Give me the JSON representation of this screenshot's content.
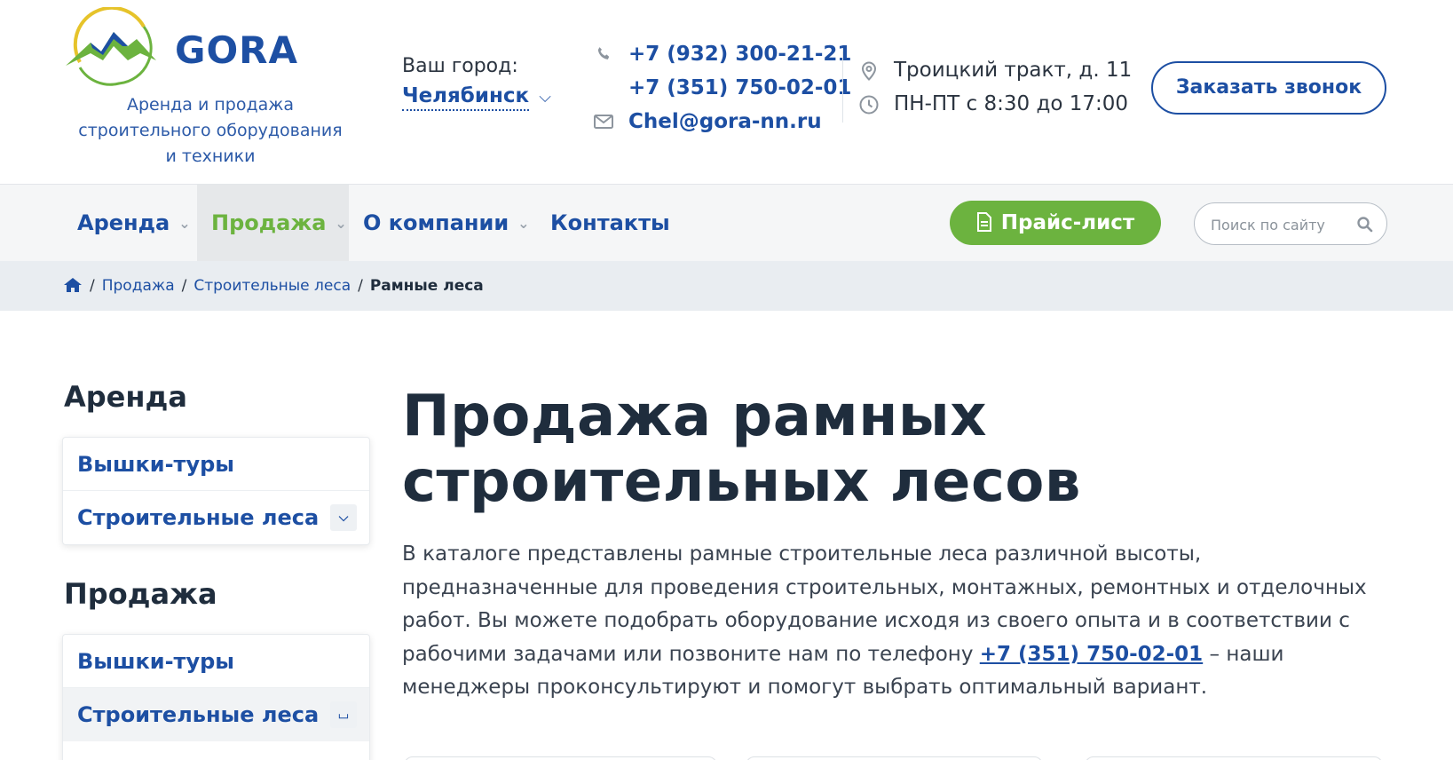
{
  "header": {
    "logo_word": "GORA",
    "tagline": [
      "Аренда и продажа",
      "строительного оборудования",
      "и техники"
    ],
    "city_label": "Ваш город:",
    "city_value": "Челябинск",
    "phones": [
      "+7 (932) 300-21-21",
      "+7 (351) 750-02-01"
    ],
    "email": "Chel@gora-nn.ru",
    "address": "Троицкий тракт, д. 11",
    "hours": "ПН-ПТ с 8:30 до 17:00",
    "callback_label": "Заказать звонок"
  },
  "nav": {
    "items": [
      {
        "label": "Аренда"
      },
      {
        "label": "Продажа"
      },
      {
        "label": "О компании"
      },
      {
        "label": "Контакты"
      }
    ],
    "price_label": "Прайс-лист",
    "search_placeholder": "Поиск по сайту"
  },
  "breadcrumbs": [
    "Продажа",
    "Строительные леса",
    "Рамные леса"
  ],
  "sidebar": {
    "rent": {
      "heading": "Аренда",
      "items": [
        "Вышки-туры",
        "Строительные леса"
      ]
    },
    "sale": {
      "heading": "Продажа",
      "items": [
        "Вышки-туры",
        "Строительные леса"
      ]
    }
  },
  "main": {
    "title_lines": [
      "Продажа рамных",
      "строительных лесов"
    ],
    "intro_before": "В каталоге представлены рамные строительные леса различной высоты, предназначенные для проведения строительных, монтажных, ремонтных и отделочных работ. Вы можете подобрать оборудование исходя из своего опыта и в соответствии с рабочими задачами или позвоните нам по телефону ",
    "intro_phone": "+7 (351) 750-02-01",
    "intro_after": " – наши менеджеры проконсультируют и помогут выбрать оптимальный вариант."
  },
  "colors": {
    "brand_blue": "#1d4fa3",
    "accent_green": "#6cb33f",
    "text_dark": "#1f2d3d"
  },
  "icons": [
    "logo-mountain-icon",
    "phone-icon",
    "mail-icon",
    "location-pin-icon",
    "clock-icon",
    "chevron-down-icon",
    "document-icon",
    "search-icon",
    "home-icon",
    "chevron-up-icon"
  ]
}
